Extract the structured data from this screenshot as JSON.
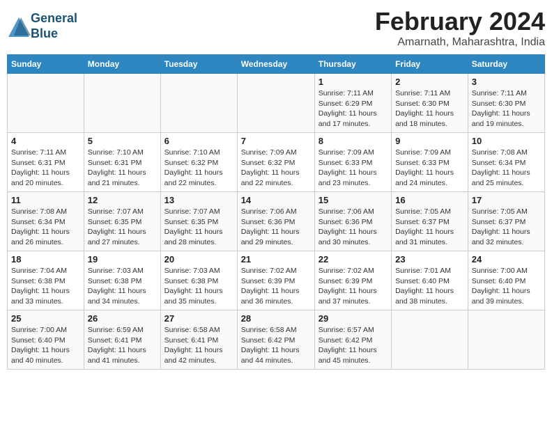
{
  "header": {
    "logo_line1": "General",
    "logo_line2": "Blue",
    "month": "February 2024",
    "location": "Amarnath, Maharashtra, India"
  },
  "weekdays": [
    "Sunday",
    "Monday",
    "Tuesday",
    "Wednesday",
    "Thursday",
    "Friday",
    "Saturday"
  ],
  "weeks": [
    [
      {
        "day": "",
        "info": ""
      },
      {
        "day": "",
        "info": ""
      },
      {
        "day": "",
        "info": ""
      },
      {
        "day": "",
        "info": ""
      },
      {
        "day": "1",
        "info": "Sunrise: 7:11 AM\nSunset: 6:29 PM\nDaylight: 11 hours and 17 minutes."
      },
      {
        "day": "2",
        "info": "Sunrise: 7:11 AM\nSunset: 6:30 PM\nDaylight: 11 hours and 18 minutes."
      },
      {
        "day": "3",
        "info": "Sunrise: 7:11 AM\nSunset: 6:30 PM\nDaylight: 11 hours and 19 minutes."
      }
    ],
    [
      {
        "day": "4",
        "info": "Sunrise: 7:11 AM\nSunset: 6:31 PM\nDaylight: 11 hours and 20 minutes."
      },
      {
        "day": "5",
        "info": "Sunrise: 7:10 AM\nSunset: 6:31 PM\nDaylight: 11 hours and 21 minutes."
      },
      {
        "day": "6",
        "info": "Sunrise: 7:10 AM\nSunset: 6:32 PM\nDaylight: 11 hours and 22 minutes."
      },
      {
        "day": "7",
        "info": "Sunrise: 7:09 AM\nSunset: 6:32 PM\nDaylight: 11 hours and 22 minutes."
      },
      {
        "day": "8",
        "info": "Sunrise: 7:09 AM\nSunset: 6:33 PM\nDaylight: 11 hours and 23 minutes."
      },
      {
        "day": "9",
        "info": "Sunrise: 7:09 AM\nSunset: 6:33 PM\nDaylight: 11 hours and 24 minutes."
      },
      {
        "day": "10",
        "info": "Sunrise: 7:08 AM\nSunset: 6:34 PM\nDaylight: 11 hours and 25 minutes."
      }
    ],
    [
      {
        "day": "11",
        "info": "Sunrise: 7:08 AM\nSunset: 6:34 PM\nDaylight: 11 hours and 26 minutes."
      },
      {
        "day": "12",
        "info": "Sunrise: 7:07 AM\nSunset: 6:35 PM\nDaylight: 11 hours and 27 minutes."
      },
      {
        "day": "13",
        "info": "Sunrise: 7:07 AM\nSunset: 6:35 PM\nDaylight: 11 hours and 28 minutes."
      },
      {
        "day": "14",
        "info": "Sunrise: 7:06 AM\nSunset: 6:36 PM\nDaylight: 11 hours and 29 minutes."
      },
      {
        "day": "15",
        "info": "Sunrise: 7:06 AM\nSunset: 6:36 PM\nDaylight: 11 hours and 30 minutes."
      },
      {
        "day": "16",
        "info": "Sunrise: 7:05 AM\nSunset: 6:37 PM\nDaylight: 11 hours and 31 minutes."
      },
      {
        "day": "17",
        "info": "Sunrise: 7:05 AM\nSunset: 6:37 PM\nDaylight: 11 hours and 32 minutes."
      }
    ],
    [
      {
        "day": "18",
        "info": "Sunrise: 7:04 AM\nSunset: 6:38 PM\nDaylight: 11 hours and 33 minutes."
      },
      {
        "day": "19",
        "info": "Sunrise: 7:03 AM\nSunset: 6:38 PM\nDaylight: 11 hours and 34 minutes."
      },
      {
        "day": "20",
        "info": "Sunrise: 7:03 AM\nSunset: 6:38 PM\nDaylight: 11 hours and 35 minutes."
      },
      {
        "day": "21",
        "info": "Sunrise: 7:02 AM\nSunset: 6:39 PM\nDaylight: 11 hours and 36 minutes."
      },
      {
        "day": "22",
        "info": "Sunrise: 7:02 AM\nSunset: 6:39 PM\nDaylight: 11 hours and 37 minutes."
      },
      {
        "day": "23",
        "info": "Sunrise: 7:01 AM\nSunset: 6:40 PM\nDaylight: 11 hours and 38 minutes."
      },
      {
        "day": "24",
        "info": "Sunrise: 7:00 AM\nSunset: 6:40 PM\nDaylight: 11 hours and 39 minutes."
      }
    ],
    [
      {
        "day": "25",
        "info": "Sunrise: 7:00 AM\nSunset: 6:40 PM\nDaylight: 11 hours and 40 minutes."
      },
      {
        "day": "26",
        "info": "Sunrise: 6:59 AM\nSunset: 6:41 PM\nDaylight: 11 hours and 41 minutes."
      },
      {
        "day": "27",
        "info": "Sunrise: 6:58 AM\nSunset: 6:41 PM\nDaylight: 11 hours and 42 minutes."
      },
      {
        "day": "28",
        "info": "Sunrise: 6:58 AM\nSunset: 6:42 PM\nDaylight: 11 hours and 44 minutes."
      },
      {
        "day": "29",
        "info": "Sunrise: 6:57 AM\nSunset: 6:42 PM\nDaylight: 11 hours and 45 minutes."
      },
      {
        "day": "",
        "info": ""
      },
      {
        "day": "",
        "info": ""
      }
    ]
  ]
}
